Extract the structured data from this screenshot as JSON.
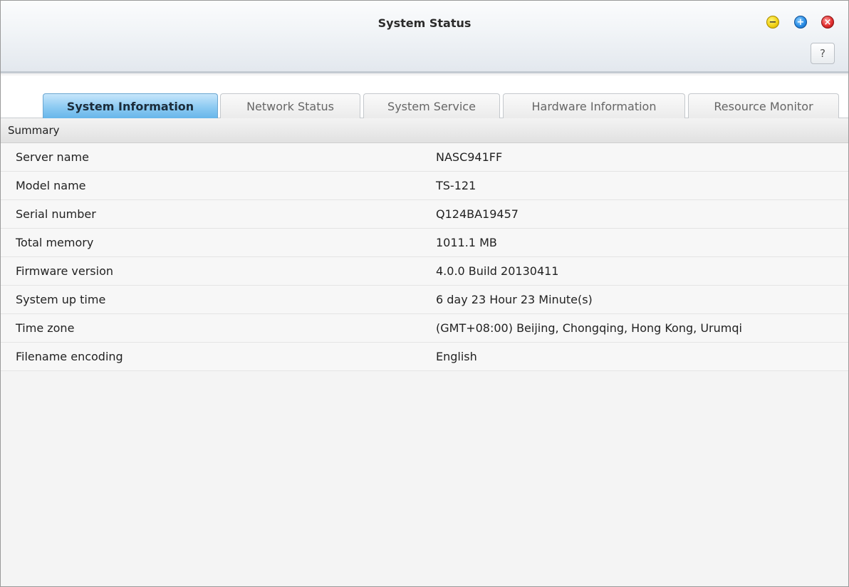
{
  "window": {
    "title": "System Status",
    "minimize_glyph": "−",
    "maximize_glyph": "+",
    "close_glyph": "×",
    "help_label": "?"
  },
  "tabs": [
    {
      "label": "System Information",
      "active": true
    },
    {
      "label": "Network Status",
      "active": false
    },
    {
      "label": "System Service",
      "active": false
    },
    {
      "label": "Hardware Information",
      "active": false
    },
    {
      "label": "Resource Monitor",
      "active": false
    }
  ],
  "summary": {
    "header": "Summary",
    "rows": [
      {
        "label": "Server name",
        "value": "NASC941FF"
      },
      {
        "label": "Model name",
        "value": "TS-121"
      },
      {
        "label": "Serial number",
        "value": "Q124BA19457"
      },
      {
        "label": "Total memory",
        "value": "1011.1 MB"
      },
      {
        "label": "Firmware version",
        "value": "4.0.0 Build 20130411"
      },
      {
        "label": "System up time",
        "value": "6 day 23 Hour 23 Minute(s)"
      },
      {
        "label": "Time zone",
        "value": "(GMT+08:00) Beijing, Chongqing, Hong Kong, Urumqi"
      },
      {
        "label": "Filename encoding",
        "value": "English"
      }
    ]
  },
  "colors": {
    "active_tab": "#8ccaf2",
    "minimize": "#f2d316",
    "maximize": "#2b8ee6",
    "close": "#e23030"
  }
}
